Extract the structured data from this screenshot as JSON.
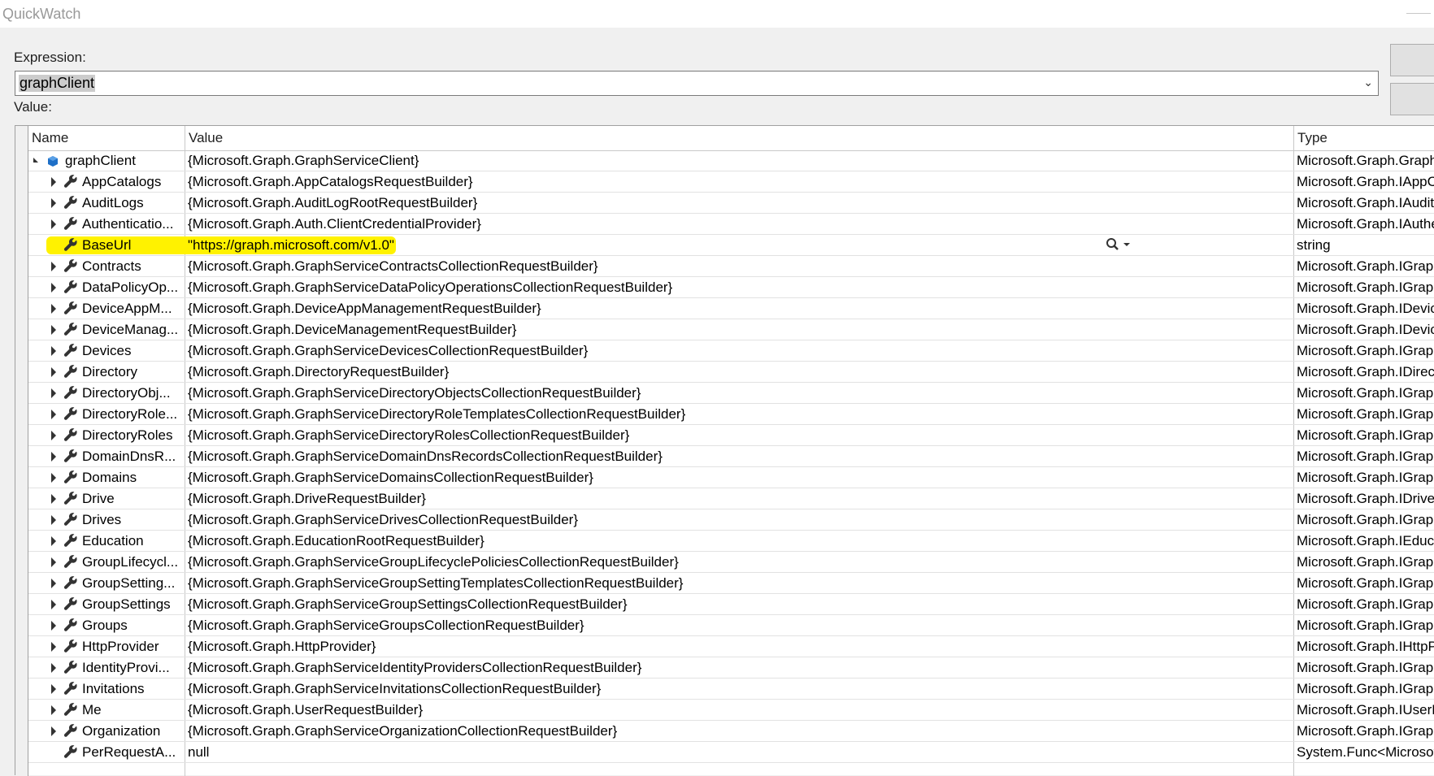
{
  "window": {
    "title": "QuickWatch"
  },
  "expression": {
    "label": "Expression:",
    "value": "graphClient"
  },
  "value_label": "Value:",
  "columns": {
    "name": "Name",
    "value": "Value",
    "type": "Type"
  },
  "rows": [
    {
      "depth": 0,
      "expander": "open",
      "icon": "object-icon",
      "name": "graphClient",
      "value": "{Microsoft.Graph.GraphServiceClient}",
      "type": "Microsoft.Graph.GraphSe"
    },
    {
      "depth": 1,
      "expander": "closed",
      "icon": "wrench-icon",
      "name": "AppCatalogs",
      "value": "{Microsoft.Graph.AppCatalogsRequestBuilder}",
      "type": "Microsoft.Graph.IAppCat"
    },
    {
      "depth": 1,
      "expander": "closed",
      "icon": "wrench-icon",
      "name": "AuditLogs",
      "value": "{Microsoft.Graph.AuditLogRootRequestBuilder}",
      "type": "Microsoft.Graph.IAuditLo"
    },
    {
      "depth": 1,
      "expander": "closed",
      "icon": "wrench-icon",
      "name": "Authenticatio...",
      "value": "{Microsoft.Graph.Auth.ClientCredentialProvider}",
      "type": "Microsoft.Graph.IAuthen"
    },
    {
      "depth": 1,
      "expander": "none",
      "icon": "wrench-icon",
      "name": "BaseUrl",
      "value": "\"https://graph.microsoft.com/v1.0\"",
      "type": "string",
      "highlight": true,
      "magnifier": true
    },
    {
      "depth": 1,
      "expander": "closed",
      "icon": "wrench-icon",
      "name": "Contracts",
      "value": "{Microsoft.Graph.GraphServiceContractsCollectionRequestBuilder}",
      "type": "Microsoft.Graph.IGraphS"
    },
    {
      "depth": 1,
      "expander": "closed",
      "icon": "wrench-icon",
      "name": "DataPolicyOp...",
      "value": "{Microsoft.Graph.GraphServiceDataPolicyOperationsCollectionRequestBuilder}",
      "type": "Microsoft.Graph.IGraphS"
    },
    {
      "depth": 1,
      "expander": "closed",
      "icon": "wrench-icon",
      "name": "DeviceAppM...",
      "value": "{Microsoft.Graph.DeviceAppManagementRequestBuilder}",
      "type": "Microsoft.Graph.IDevice/"
    },
    {
      "depth": 1,
      "expander": "closed",
      "icon": "wrench-icon",
      "name": "DeviceManag...",
      "value": "{Microsoft.Graph.DeviceManagementRequestBuilder}",
      "type": "Microsoft.Graph.IDeviceI"
    },
    {
      "depth": 1,
      "expander": "closed",
      "icon": "wrench-icon",
      "name": "Devices",
      "value": "{Microsoft.Graph.GraphServiceDevicesCollectionRequestBuilder}",
      "type": "Microsoft.Graph.IGraphS"
    },
    {
      "depth": 1,
      "expander": "closed",
      "icon": "wrench-icon",
      "name": "Directory",
      "value": "{Microsoft.Graph.DirectoryRequestBuilder}",
      "type": "Microsoft.Graph.IDirecto"
    },
    {
      "depth": 1,
      "expander": "closed",
      "icon": "wrench-icon",
      "name": "DirectoryObj...",
      "value": "{Microsoft.Graph.GraphServiceDirectoryObjectsCollectionRequestBuilder}",
      "type": "Microsoft.Graph.IGraphS"
    },
    {
      "depth": 1,
      "expander": "closed",
      "icon": "wrench-icon",
      "name": "DirectoryRole...",
      "value": "{Microsoft.Graph.GraphServiceDirectoryRoleTemplatesCollectionRequestBuilder}",
      "type": "Microsoft.Graph.IGraphS"
    },
    {
      "depth": 1,
      "expander": "closed",
      "icon": "wrench-icon",
      "name": "DirectoryRoles",
      "value": "{Microsoft.Graph.GraphServiceDirectoryRolesCollectionRequestBuilder}",
      "type": "Microsoft.Graph.IGraphS"
    },
    {
      "depth": 1,
      "expander": "closed",
      "icon": "wrench-icon",
      "name": "DomainDnsR...",
      "value": "{Microsoft.Graph.GraphServiceDomainDnsRecordsCollectionRequestBuilder}",
      "type": "Microsoft.Graph.IGraphS"
    },
    {
      "depth": 1,
      "expander": "closed",
      "icon": "wrench-icon",
      "name": "Domains",
      "value": "{Microsoft.Graph.GraphServiceDomainsCollectionRequestBuilder}",
      "type": "Microsoft.Graph.IGraphS"
    },
    {
      "depth": 1,
      "expander": "closed",
      "icon": "wrench-icon",
      "name": "Drive",
      "value": "{Microsoft.Graph.DriveRequestBuilder}",
      "type": "Microsoft.Graph.IDriveRe"
    },
    {
      "depth": 1,
      "expander": "closed",
      "icon": "wrench-icon",
      "name": "Drives",
      "value": "{Microsoft.Graph.GraphServiceDrivesCollectionRequestBuilder}",
      "type": "Microsoft.Graph.IGraphS"
    },
    {
      "depth": 1,
      "expander": "closed",
      "icon": "wrench-icon",
      "name": "Education",
      "value": "{Microsoft.Graph.EducationRootRequestBuilder}",
      "type": "Microsoft.Graph.IEducati"
    },
    {
      "depth": 1,
      "expander": "closed",
      "icon": "wrench-icon",
      "name": "GroupLifecycl...",
      "value": "{Microsoft.Graph.GraphServiceGroupLifecyclePoliciesCollectionRequestBuilder}",
      "type": "Microsoft.Graph.IGraphS"
    },
    {
      "depth": 1,
      "expander": "closed",
      "icon": "wrench-icon",
      "name": "GroupSetting...",
      "value": "{Microsoft.Graph.GraphServiceGroupSettingTemplatesCollectionRequestBuilder}",
      "type": "Microsoft.Graph.IGraphS"
    },
    {
      "depth": 1,
      "expander": "closed",
      "icon": "wrench-icon",
      "name": "GroupSettings",
      "value": "{Microsoft.Graph.GraphServiceGroupSettingsCollectionRequestBuilder}",
      "type": "Microsoft.Graph.IGraphS"
    },
    {
      "depth": 1,
      "expander": "closed",
      "icon": "wrench-icon",
      "name": "Groups",
      "value": "{Microsoft.Graph.GraphServiceGroupsCollectionRequestBuilder}",
      "type": "Microsoft.Graph.IGraphS"
    },
    {
      "depth": 1,
      "expander": "closed",
      "icon": "wrench-icon",
      "name": "HttpProvider",
      "value": "{Microsoft.Graph.HttpProvider}",
      "type": "Microsoft.Graph.IHttpPro"
    },
    {
      "depth": 1,
      "expander": "closed",
      "icon": "wrench-icon",
      "name": "IdentityProvi...",
      "value": "{Microsoft.Graph.GraphServiceIdentityProvidersCollectionRequestBuilder}",
      "type": "Microsoft.Graph.IGraphS"
    },
    {
      "depth": 1,
      "expander": "closed",
      "icon": "wrench-icon",
      "name": "Invitations",
      "value": "{Microsoft.Graph.GraphServiceInvitationsCollectionRequestBuilder}",
      "type": "Microsoft.Graph.IGraphS"
    },
    {
      "depth": 1,
      "expander": "closed",
      "icon": "wrench-icon",
      "name": "Me",
      "value": "{Microsoft.Graph.UserRequestBuilder}",
      "type": "Microsoft.Graph.IUserRe"
    },
    {
      "depth": 1,
      "expander": "closed",
      "icon": "wrench-icon",
      "name": "Organization",
      "value": "{Microsoft.Graph.GraphServiceOrganizationCollectionRequestBuilder}",
      "type": "Microsoft.Graph.IGraphS"
    },
    {
      "depth": 1,
      "expander": "none",
      "icon": "wrench-icon",
      "name": "PerRequestA...",
      "value": "null",
      "type": "System.Func<Microsoft.C"
    }
  ],
  "colors": {
    "highlight": "#fff200",
    "grid_line": "#e2e2e2",
    "wrench": "#333333",
    "object_icon": "#1e6fc7"
  }
}
